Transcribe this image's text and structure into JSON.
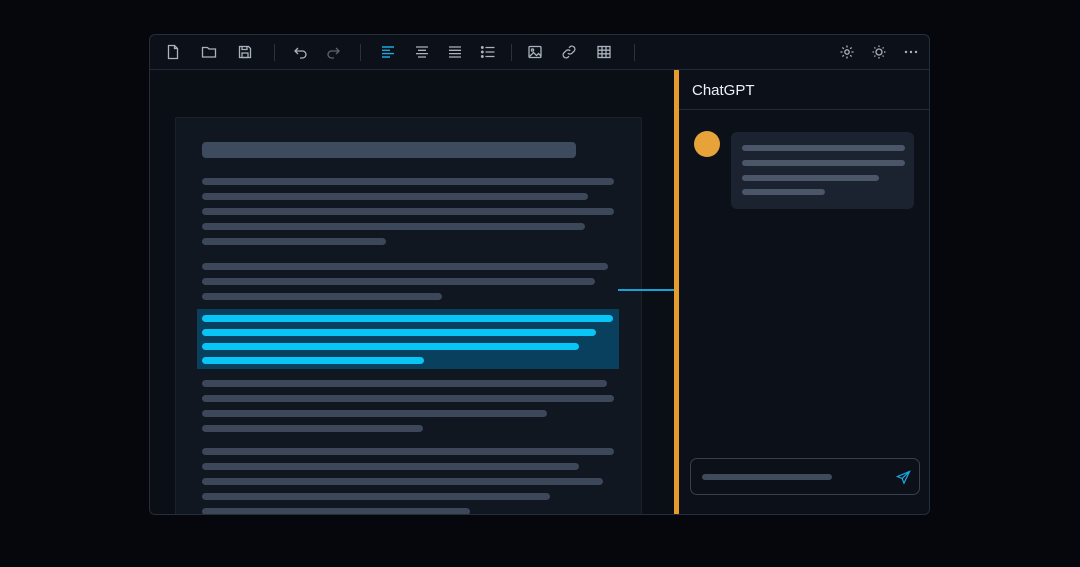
{
  "chat": {
    "title": "ChatGPT"
  },
  "toolbar": {
    "icons": [
      "new-file-icon",
      "open-folder-icon",
      "save-icon",
      "undo-icon",
      "redo-icon",
      "align-left-icon",
      "align-center-icon",
      "align-justify-icon",
      "list-icon",
      "image-icon",
      "link-icon",
      "table-icon",
      "settings-icon",
      "theme-icon",
      "more-icon"
    ],
    "active_icon": "align-left-icon"
  },
  "colors": {
    "accent": "#e59c2c",
    "highlight": "#08c5f5",
    "active_icon": "#19a9e4"
  }
}
